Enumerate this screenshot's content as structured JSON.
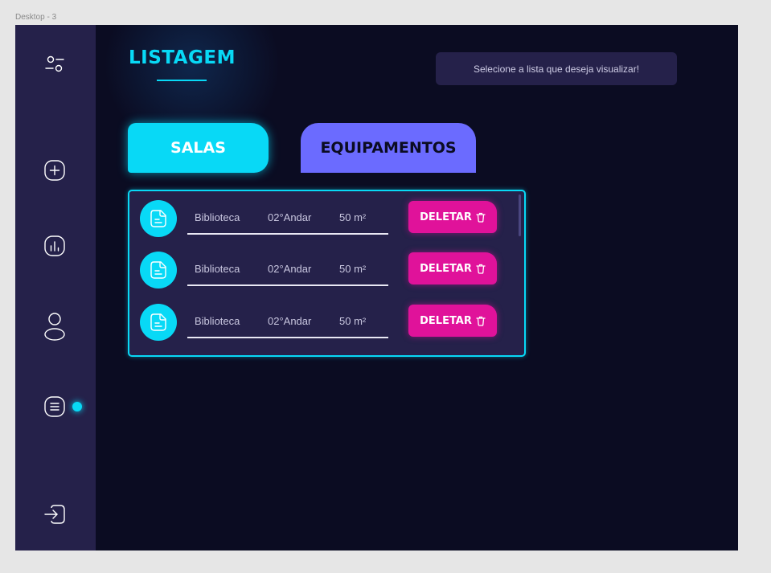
{
  "frame_label": "Desktop - 3",
  "page_title": "LISTAGEM",
  "hint": "Selecione a lista que deseja visualizar!",
  "tabs": {
    "salas": "SALAS",
    "equipamentos": "EQUIPAMENTOS"
  },
  "sidebar": {
    "icons": [
      "settings-toggle-icon",
      "add-icon",
      "chart-icon",
      "user-icon",
      "list-icon",
      "logout-icon"
    ],
    "active": "list-icon"
  },
  "rows": [
    {
      "name": "Biblioteca",
      "floor": "02°Andar",
      "area": "50 m²",
      "action": "DELETAR"
    },
    {
      "name": "Biblioteca",
      "floor": "02°Andar",
      "area": "50 m²",
      "action": "DELETAR"
    },
    {
      "name": "Biblioteca",
      "floor": "02°Andar",
      "area": "50 m²",
      "action": "DELETAR"
    }
  ],
  "colors": {
    "background": "#0b0c22",
    "sidebar": "#25214a",
    "accent_cyan": "#08d9f6",
    "accent_purple": "#6b6bff",
    "delete_pink": "#e0129a"
  }
}
